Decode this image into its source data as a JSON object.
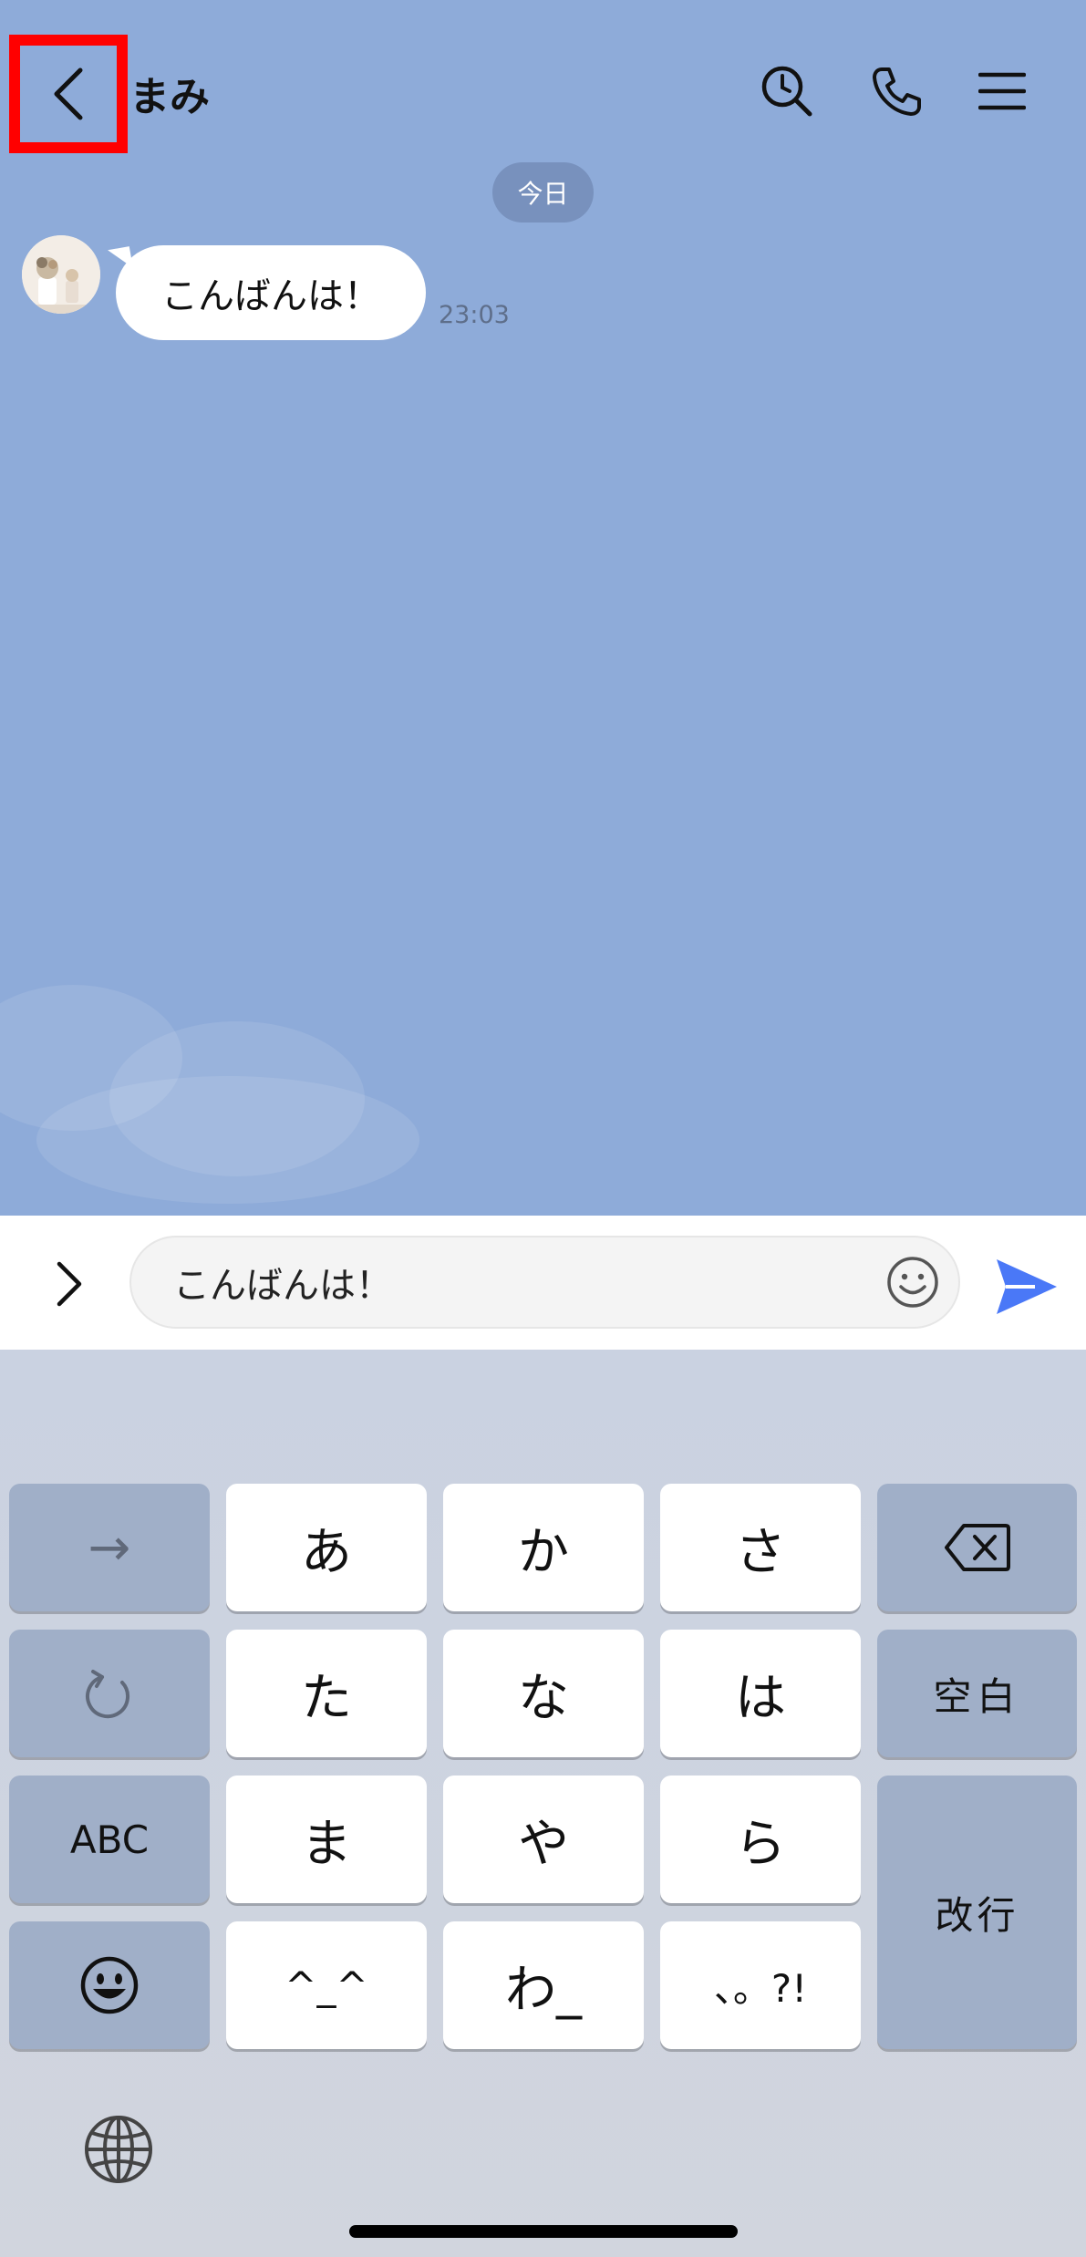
{
  "header": {
    "contact_name": "まみ",
    "back_icon": "chevron-left-icon",
    "search_icon": "search-clock-icon",
    "call_icon": "phone-icon",
    "menu_icon": "menu-icon",
    "highlight_color": "#ff0000"
  },
  "chat": {
    "background_color": "#8eabd9",
    "date_label": "今日",
    "messages": [
      {
        "sender": "まみ",
        "text": "こんばんは！",
        "time": "23:03"
      }
    ]
  },
  "input_bar": {
    "value": "こんばんは！",
    "expand_icon": "chevron-right-icon",
    "emoji_icon": "smiley-icon",
    "send_icon": "send-icon",
    "send_color": "#4a78f7"
  },
  "keyboard": {
    "keys": {
      "arrow": "→",
      "a": "あ",
      "ka": "か",
      "sa": "さ",
      "ta": "た",
      "na": "な",
      "ha": "は",
      "space": "空白",
      "abc": "ABC",
      "ma": "ま",
      "ya": "や",
      "ra": "ら",
      "return": "改行",
      "kaomoji": "^_^",
      "wa": "わ_",
      "punct": "、。?!"
    },
    "icons": [
      "backspace-icon",
      "undo-icon",
      "emoji-icon",
      "globe-icon"
    ]
  }
}
